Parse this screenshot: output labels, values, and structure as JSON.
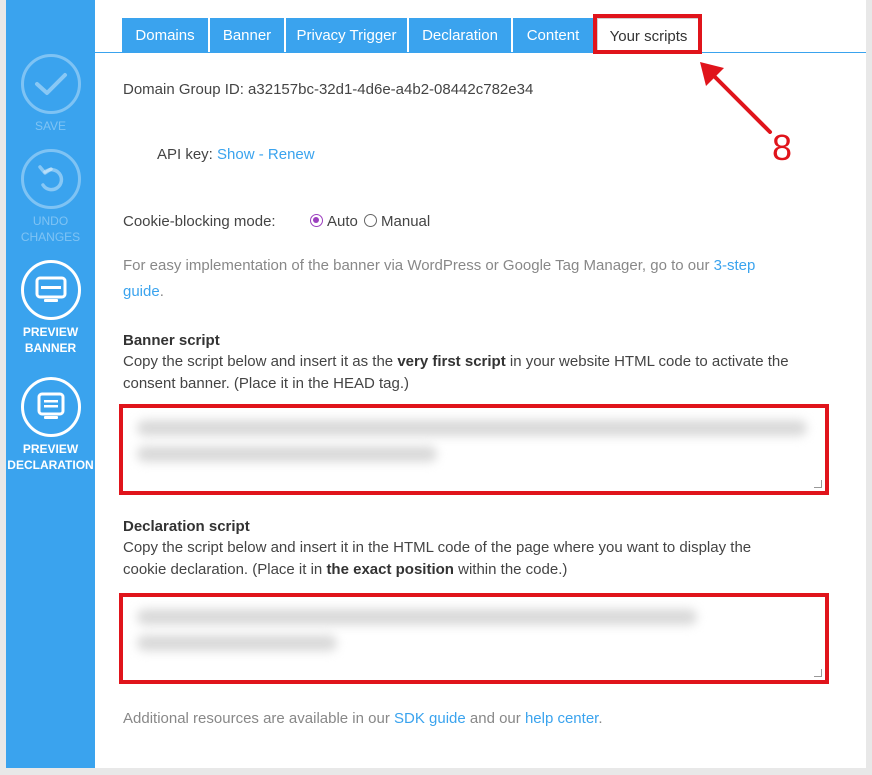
{
  "tabs": [
    {
      "label": "Domains"
    },
    {
      "label": "Banner"
    },
    {
      "label": "Privacy Trigger"
    },
    {
      "label": "Declaration"
    },
    {
      "label": "Content"
    },
    {
      "label": "Your scripts",
      "active": true
    }
  ],
  "sidebar": {
    "save": {
      "label": "SAVE",
      "icon": "checkmark-icon",
      "enabled": false
    },
    "undo": {
      "label_line1": "UNDO",
      "label_line2": "CHANGES",
      "icon": "undo-icon",
      "enabled": false
    },
    "preview_banner": {
      "label_line1": "PREVIEW",
      "label_line2": "BANNER",
      "icon": "monitor-icon"
    },
    "preview_declaration": {
      "label_line1": "PREVIEW",
      "label_line2": "DECLARATION",
      "icon": "document-icon"
    }
  },
  "domain_group": {
    "text": "Domain Group ID: a32157bc-32d1-4d6e-a4b2-08442c782e34"
  },
  "api_key": {
    "label": "API key:",
    "show": "Show",
    "separator": "-",
    "renew": "Renew"
  },
  "cookie_blocking": {
    "label": "Cookie-blocking mode:",
    "options": [
      "Auto",
      "Manual"
    ],
    "selected": "Auto"
  },
  "implementation": {
    "text_before": "For easy implementation of the banner via WordPress or Google Tag Manager, go to our ",
    "link_part1": "3-step",
    "link_part2": "guide",
    "text_after": "."
  },
  "banner_script": {
    "title": "Banner script",
    "desc_line1_before": "Copy the script below and insert it as the ",
    "desc_bold": "very first script",
    "desc_line1_after": " in your website HTML code to activate the",
    "desc_line2": "consent banner. (Place it in the HEAD tag.)"
  },
  "declaration_script": {
    "title": "Declaration script",
    "desc_line1": "Copy the script below and insert it in the HTML code of the page where you want to display the",
    "desc_line2_before": "cookie declaration. (Place it in ",
    "desc_bold": "the exact position",
    "desc_line2_after": " within the code.)"
  },
  "resources": {
    "text_before": "Additional resources are available in our ",
    "sdk_link": "SDK guide",
    "text_mid": " and our ",
    "help_link": "help center",
    "text_after": "."
  },
  "annotation": {
    "number": "8",
    "color": "#e0141b"
  },
  "colors": {
    "accent": "#3aa3ee",
    "highlight": "#e0141b",
    "radio": "#9c3fbf"
  }
}
